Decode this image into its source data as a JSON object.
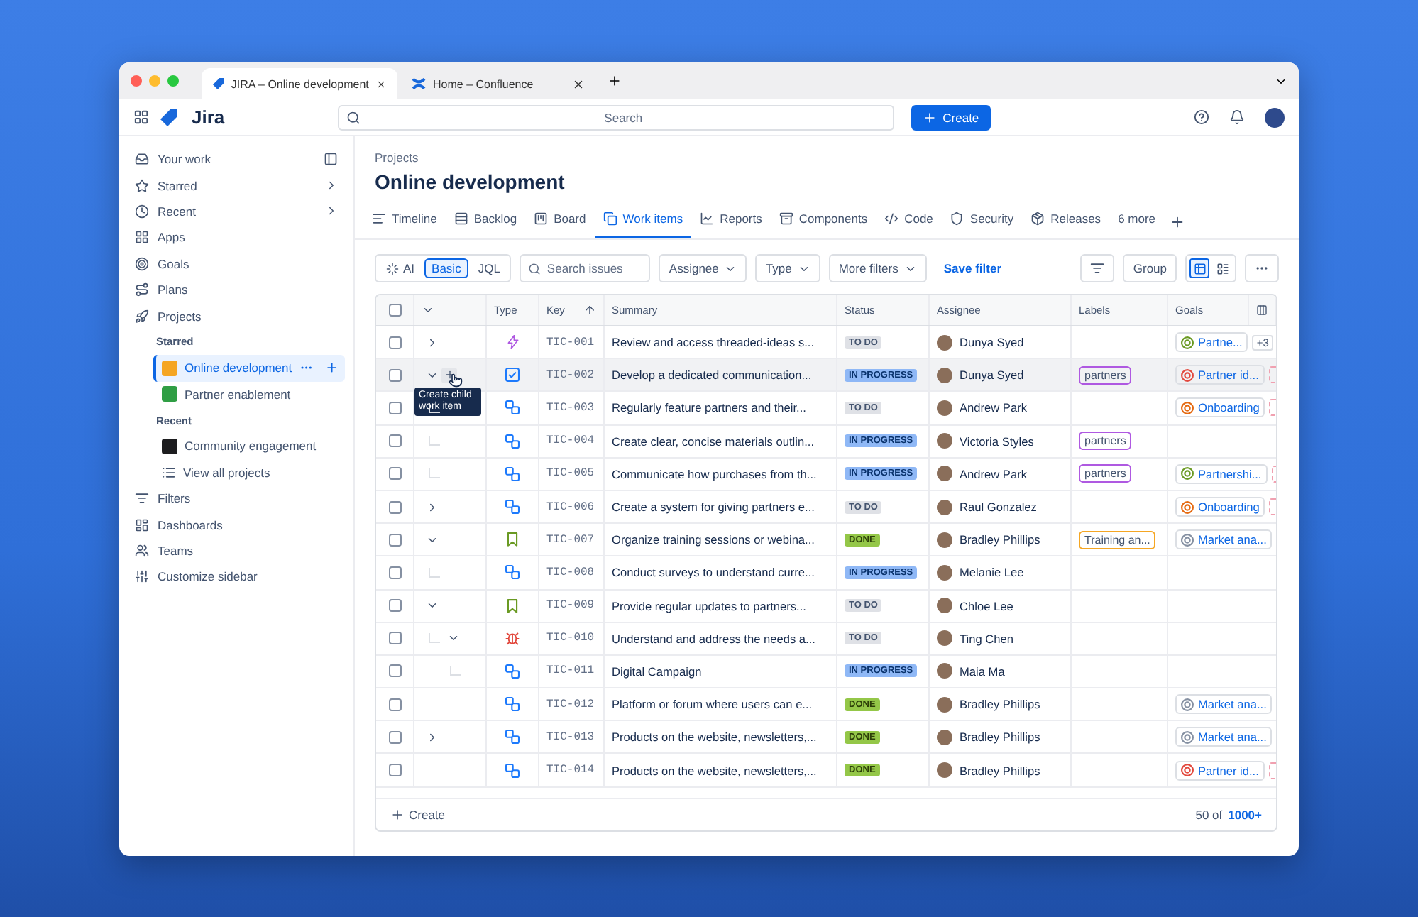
{
  "browser_tabs": [
    {
      "title": "JIRA – Online development",
      "selected": true
    },
    {
      "title": "Home – Confluence",
      "selected": false
    }
  ],
  "top_nav": {
    "product": "Jira",
    "search": {
      "placeholder": "Search"
    },
    "create_button": "Create"
  },
  "sidebar": {
    "items": [
      {
        "label": "Your work"
      },
      {
        "label": "Starred"
      },
      {
        "label": "Recent"
      },
      {
        "label": "Apps"
      },
      {
        "label": "Goals"
      },
      {
        "label": "Plans"
      },
      {
        "label": "Projects",
        "children": [
          {
            "kind": "heading",
            "label": "Starred"
          },
          {
            "kind": "project",
            "label": "Online development",
            "color": "#f5a623",
            "selected": true
          },
          {
            "kind": "project",
            "label": "Partner enablement",
            "color": "#2f9e44",
            "selected": false
          },
          {
            "kind": "heading",
            "label": "Recent"
          },
          {
            "kind": "project",
            "label": "Community engagement",
            "color": "#1d1d1f",
            "selected": false
          },
          {
            "kind": "link",
            "label": "View all projects"
          }
        ]
      },
      {
        "label": "Filters"
      },
      {
        "label": "Dashboards"
      },
      {
        "label": "Teams"
      },
      {
        "label": "Customize sidebar"
      }
    ]
  },
  "project": {
    "breadcrumb": "Projects",
    "title": "Online development",
    "tabs": [
      {
        "label": "Timeline",
        "selected": false
      },
      {
        "label": "Backlog",
        "selected": false
      },
      {
        "label": "Board",
        "selected": false
      },
      {
        "label": "Work items",
        "selected": true
      },
      {
        "label": "Reports",
        "selected": false
      },
      {
        "label": "Components",
        "selected": false
      },
      {
        "label": "Code",
        "selected": false
      },
      {
        "label": "Security",
        "selected": false
      },
      {
        "label": "Releases",
        "selected": false
      },
      {
        "label": "6 more",
        "selected": false
      }
    ]
  },
  "filters": {
    "modes": [
      {
        "label": "AI",
        "selected": false
      },
      {
        "label": "Basic",
        "selected": true
      },
      {
        "label": "JQL",
        "selected": false
      }
    ],
    "search": {
      "placeholder": "Search issues"
    },
    "dropdowns": [
      "Assignee",
      "Type",
      "More filters"
    ],
    "save_filter": "Save filter",
    "group_button": "Group",
    "views": [
      {
        "selected": true
      },
      {
        "selected": false
      }
    ]
  },
  "table": {
    "columns": [
      "Type",
      "Key",
      "Summary",
      "Status",
      "Assignee",
      "Labels",
      "Goals"
    ],
    "header_checkbox": {
      "checked": false
    },
    "tooltip": "Create child work item",
    "rows": [
      {
        "key": "TIC-001",
        "summary": "Review and access threaded-ideas s...",
        "kind": "idea",
        "status": {
          "label": "TO DO",
          "kind": "todo"
        },
        "assignee": "Dunya Syed",
        "checked": false,
        "hovered": false,
        "expanded": false,
        "goal": {
          "label": "Partne...",
          "color": "#6a9a23",
          "extra": "+3"
        }
      },
      {
        "key": "TIC-002",
        "summary": "Develop a dedicated communication...",
        "kind": "task",
        "status": {
          "label": "IN PROGRESS",
          "kind": "in_progress"
        },
        "assignee": "Dunya Syed",
        "checked": false,
        "hovered": true,
        "expanded": true,
        "labels": [
          {
            "label": "partners",
            "color": "#af59e1"
          }
        ],
        "goal": {
          "label": "Partner id...",
          "color": "#e2483d"
        },
        "children": [
          {
            "key": "TIC-003",
            "summary": "Regularly feature partners and their...",
            "kind": "subtask",
            "status": {
              "label": "TO DO",
              "kind": "todo"
            },
            "assignee": "Andrew Park",
            "checked": false,
            "hovered": false,
            "goal": {
              "label": "Onboarding",
              "color": "#e56910"
            }
          },
          {
            "key": "TIC-004",
            "summary": "Create clear, concise materials outlin...",
            "kind": "subtask",
            "status": {
              "label": "IN PROGRESS",
              "kind": "in_progress"
            },
            "assignee": "Victoria Styles",
            "checked": false,
            "hovered": false,
            "labels": [
              {
                "label": "partners",
                "color": "#af59e1"
              }
            ]
          },
          {
            "key": "TIC-005",
            "summary": "Communicate how purchases from th...",
            "kind": "subtask",
            "status": {
              "label": "IN PROGRESS",
              "kind": "in_progress"
            },
            "assignee": "Andrew Park",
            "checked": false,
            "hovered": false,
            "labels": [
              {
                "label": "partners",
                "color": "#af59e1"
              }
            ],
            "goal": {
              "label": "Partnershi...",
              "color": "#6a9a23"
            }
          }
        ]
      },
      {
        "key": "TIC-006",
        "summary": "Create a system for giving partners e...",
        "kind": "subtask",
        "status": {
          "label": "TO DO",
          "kind": "todo"
        },
        "assignee": "Raul Gonzalez",
        "checked": false,
        "hovered": false,
        "expanded": false,
        "goal": {
          "label": "Onboarding",
          "color": "#e56910"
        }
      },
      {
        "key": "TIC-007",
        "summary": "Organize training sessions or webina...",
        "kind": "story",
        "status": {
          "label": "DONE",
          "kind": "done"
        },
        "assignee": "Bradley Phillips",
        "checked": false,
        "hovered": false,
        "expanded": true,
        "labels": [
          {
            "label": "Training an...",
            "color": "#f5a623"
          }
        ],
        "goal": {
          "label": "Market ana...",
          "color": "#8590a2"
        },
        "children": [
          {
            "key": "TIC-008",
            "summary": "Conduct surveys to understand curre...",
            "kind": "subtask",
            "status": {
              "label": "IN PROGRESS",
              "kind": "in_progress"
            },
            "assignee": "Melanie Lee",
            "checked": false,
            "hovered": false
          }
        ]
      },
      {
        "key": "TIC-009",
        "summary": "Provide regular updates to partners...",
        "kind": "story",
        "status": {
          "label": "TO DO",
          "kind": "todo"
        },
        "assignee": "Chloe Lee",
        "checked": false,
        "hovered": false,
        "expanded": true,
        "children": [
          {
            "key": "TIC-010",
            "summary": "Understand and address the needs a...",
            "kind": "bug",
            "status": {
              "label": "TO DO",
              "kind": "todo"
            },
            "assignee": "Ting Chen",
            "checked": false,
            "hovered": false,
            "expanded": true,
            "children": [
              {
                "key": "TIC-011",
                "summary": "Digital Campaign",
                "kind": "subtask",
                "status": {
                  "label": "IN PROGRESS",
                  "kind": "in_progress"
                },
                "assignee": "Maia Ma",
                "checked": false,
                "hovered": false
              }
            ]
          }
        ]
      },
      {
        "key": "TIC-012",
        "summary": "Platform or forum where users can e...",
        "kind": "subtask",
        "status": {
          "label": "DONE",
          "kind": "done"
        },
        "assignee": "Bradley Phillips",
        "checked": false,
        "hovered": false,
        "goal": {
          "label": "Market ana...",
          "color": "#8590a2"
        }
      },
      {
        "key": "TIC-013",
        "summary": "Products on the website, newsletters,...",
        "kind": "subtask",
        "status": {
          "label": "DONE",
          "kind": "done"
        },
        "assignee": "Bradley Phillips",
        "checked": false,
        "hovered": false,
        "expanded": false,
        "goal": {
          "label": "Market ana...",
          "color": "#8590a2"
        }
      },
      {
        "key": "TIC-014",
        "summary": "Products on the website, newsletters,...",
        "kind": "subtask",
        "status": {
          "label": "DONE",
          "kind": "done"
        },
        "assignee": "Bradley Phillips",
        "checked": false,
        "hovered": false,
        "goal": {
          "label": "Partner id...",
          "color": "#e2483d"
        }
      }
    ],
    "footer": {
      "create": "Create",
      "count": "50 of",
      "total": "1000+"
    }
  }
}
